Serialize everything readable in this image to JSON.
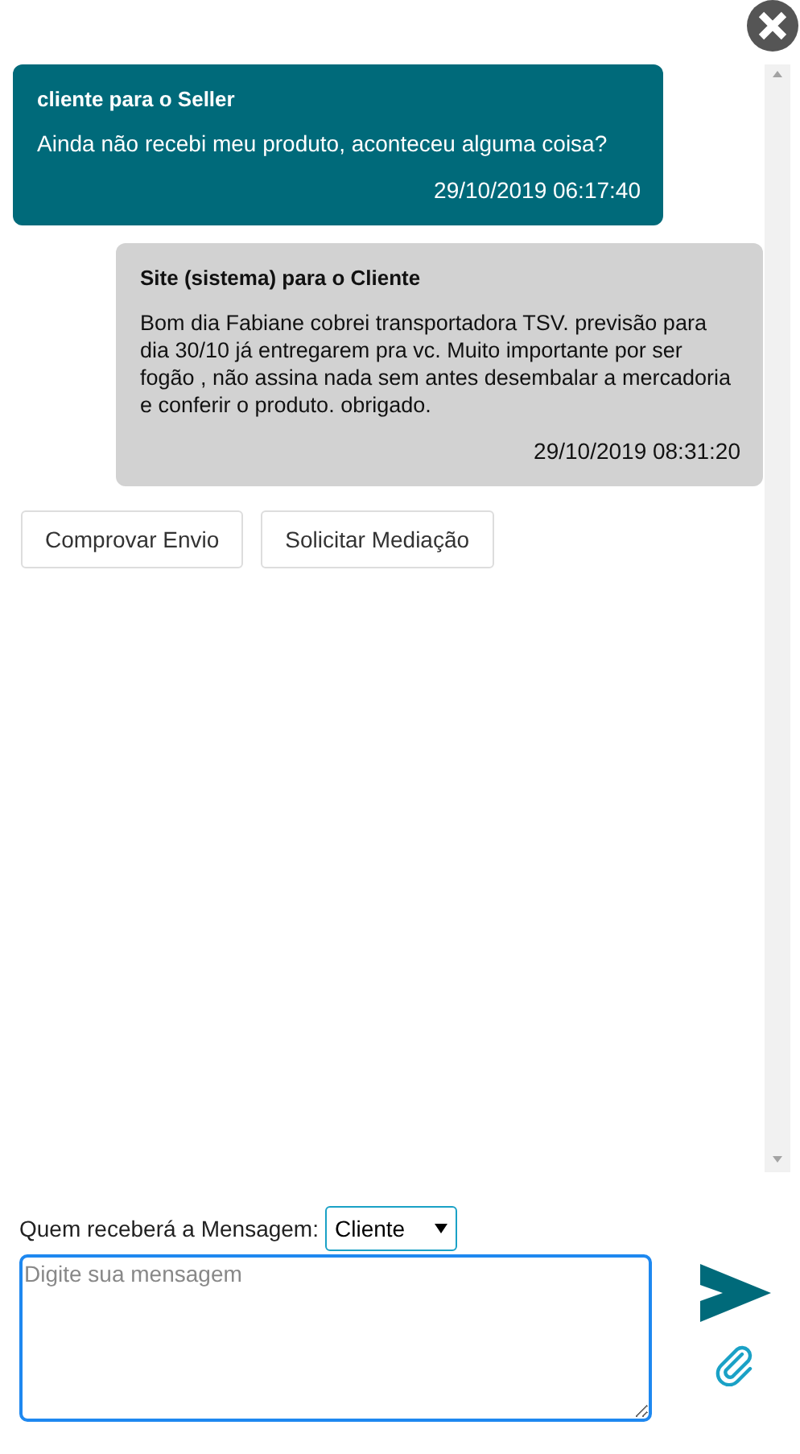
{
  "messages": [
    {
      "kind": "incoming",
      "sender": "cliente para o Seller",
      "text": "Ainda não recebi meu produto, aconteceu alguma coisa?",
      "time": "29/10/2019 06:17:40"
    },
    {
      "kind": "outgoing",
      "sender": "Site (sistema) para o Cliente",
      "text": "Bom dia Fabiane cobrei transportadora TSV. previsão para dia 30/10 já entregarem pra vc. Muito importante por ser fogão , não assina nada sem antes desembalar a mercadoria e conferir o produto. obrigado.",
      "time": "29/10/2019 08:31:20"
    }
  ],
  "actions": [
    "Comprovar Envio",
    "Solicitar Mediação"
  ],
  "recipient": {
    "label": "Quem receberá a Mensagem:",
    "value": "Cliente"
  },
  "message_field": {
    "placeholder": "Digite sua mensagem"
  }
}
